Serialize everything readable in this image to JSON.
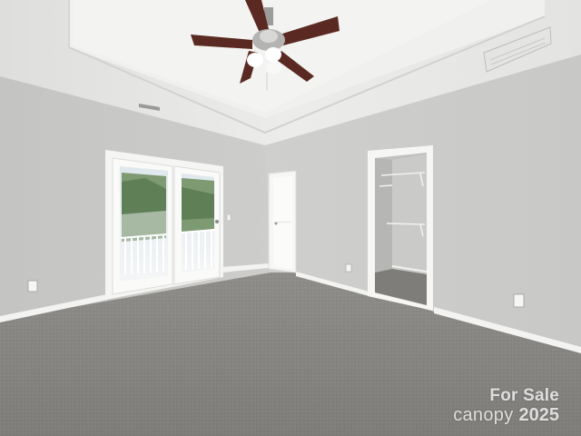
{
  "photo": {
    "subject": "empty bedroom",
    "features": [
      "ceiling-fan",
      "tray-ceiling",
      "french-doors",
      "interior-door",
      "walk-in-closet",
      "carpet",
      "hvac-vent"
    ]
  },
  "watermark": {
    "line1": "For Sale",
    "brand": "canopy",
    "year": "2025"
  },
  "colors": {
    "wall": "#cfcfcd",
    "ceiling": "#e9e9e7",
    "carpet": "#8d8b88",
    "trim": "#f4f4f2",
    "fan_blade": "#5a2a22"
  }
}
